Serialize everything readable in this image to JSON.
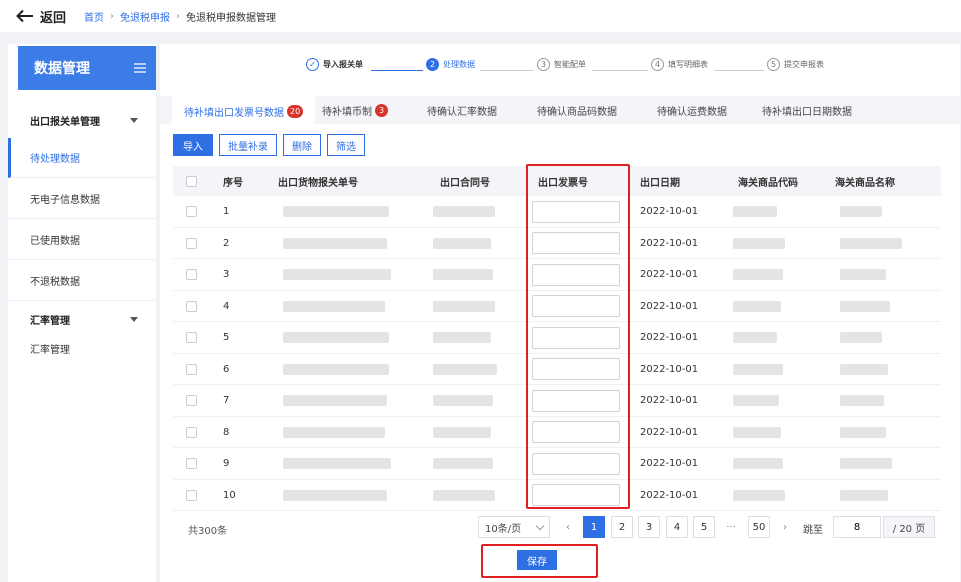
{
  "header": {
    "back_label": "返回",
    "breadcrumb": [
      "首页",
      "免退税申报"
    ],
    "breadcrumb_current": "免退税申报数据管理"
  },
  "sidebar": {
    "title": "数据管理",
    "group1": "出口报关单管理",
    "items": [
      "待处理数据",
      "无电子信息数据",
      "已使用数据",
      "不退税数据"
    ],
    "group2": "汇率管理",
    "sub": "汇率管理"
  },
  "steps": [
    {
      "num": "✓",
      "label": "导入报关单",
      "state": "done"
    },
    {
      "num": "2",
      "label": "处理数据",
      "state": "current"
    },
    {
      "num": "3",
      "label": "智能配单",
      "state": "todo"
    },
    {
      "num": "4",
      "label": "填写明细表",
      "state": "todo"
    },
    {
      "num": "5",
      "label": "提交申报表",
      "state": "todo"
    }
  ],
  "tabs": [
    {
      "label": "待补填出口发票号数据",
      "badge": "20"
    },
    {
      "label": "待补填币制",
      "badge": "3"
    },
    {
      "label": "待确认汇率数据",
      "badge": ""
    },
    {
      "label": "待确认商品码数据",
      "badge": ""
    },
    {
      "label": "待确认运费数据",
      "badge": ""
    },
    {
      "label": "待补填出口日期数据",
      "badge": ""
    }
  ],
  "toolbar": {
    "import": "导入",
    "batch": "批量补录",
    "delete": "删除",
    "filter": "筛选"
  },
  "table": {
    "columns": [
      "序号",
      "出口货物报关单号",
      "出口合同号",
      "出口发票号",
      "出口日期",
      "海关商品代码",
      "海关商品名称"
    ],
    "rows": [
      {
        "no": "1",
        "date": "2022-10-01"
      },
      {
        "no": "2",
        "date": "2022-10-01"
      },
      {
        "no": "3",
        "date": "2022-10-01"
      },
      {
        "no": "4",
        "date": "2022-10-01"
      },
      {
        "no": "5",
        "date": "2022-10-01"
      },
      {
        "no": "6",
        "date": "2022-10-01"
      },
      {
        "no": "7",
        "date": "2022-10-01"
      },
      {
        "no": "8",
        "date": "2022-10-01"
      },
      {
        "no": "9",
        "date": "2022-10-01"
      },
      {
        "no": "10",
        "date": "2022-10-01"
      }
    ]
  },
  "pagination": {
    "total": "共300条",
    "page_size": "10条/页",
    "pages": [
      "1",
      "2",
      "3",
      "4",
      "5",
      "···",
      "50"
    ],
    "jump_label": "跳至",
    "jump_value": "8",
    "page_total": "/ 20 页"
  },
  "save_label": "保存",
  "colors": {
    "accent": "#2f6fe4",
    "highlight": "#e02020",
    "badge": "#d9342b"
  }
}
